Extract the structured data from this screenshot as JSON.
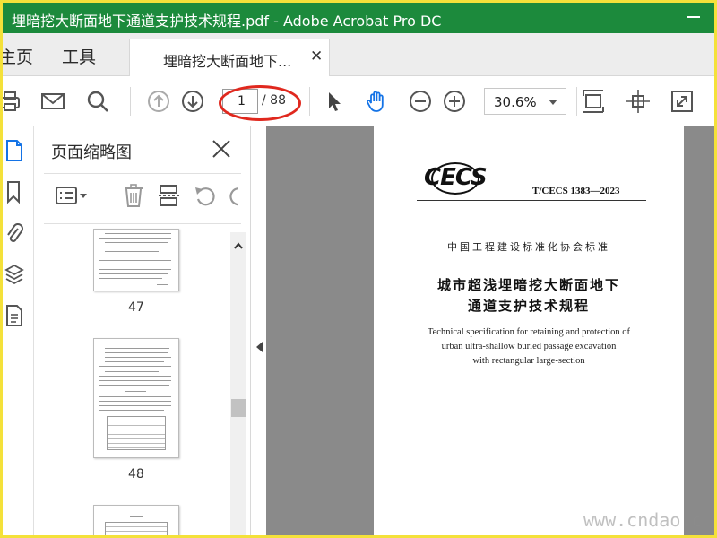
{
  "window": {
    "title": "埋暗挖大断面地下通道支护技术规程.pdf - Adobe Acrobat Pro DC"
  },
  "tabs": {
    "home": "主页",
    "tools": "工具",
    "document": "埋暗挖大断面地下..."
  },
  "toolbar": {
    "current_page": "1",
    "total_pages": "/ 88",
    "zoom": "30.6%",
    "icons": [
      "print-icon",
      "mail-icon",
      "search-icon",
      "prev-page-icon",
      "next-page-icon",
      "select-cursor-icon",
      "hand-tool-icon",
      "zoom-out-icon",
      "zoom-in-icon",
      "fit-page-icon",
      "rotate-icon",
      "fullscreen-icon"
    ]
  },
  "thumbnails_panel": {
    "title": "页面缩略图",
    "pages": [
      {
        "number": "47"
      },
      {
        "number": "48"
      },
      {
        "number": ""
      }
    ]
  },
  "document_page": {
    "logo": "CECS",
    "standard_code": "T/CECS 1383—2023",
    "association": "中国工程建设标准化协会标准",
    "title_cn_line1": "城市超浅埋暗挖大断面地下",
    "title_cn_line2": "通道支护技术规程",
    "title_en_line1": "Technical specification for retaining and protection of",
    "title_en_line2": "urban ultra-shallow buried passage excavation",
    "title_en_line3": "with rectangular large-section"
  },
  "watermark": "www.cndao.c",
  "colors": {
    "titlebar": "#1c8a3c",
    "frame": "#f4e13a",
    "annotation": "#e0281e",
    "accent": "#1473e6"
  }
}
